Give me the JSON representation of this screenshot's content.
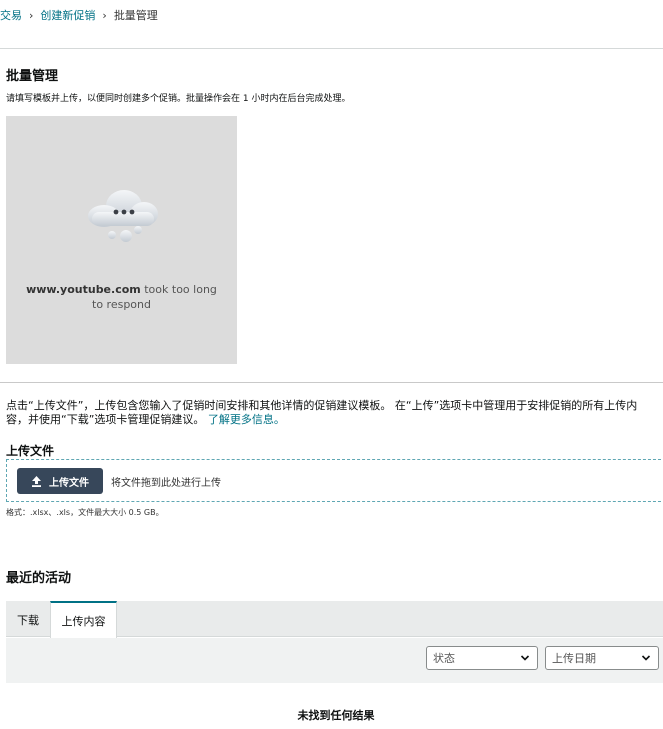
{
  "breadcrumb": {
    "items": [
      "交易",
      "创建新促销"
    ],
    "current": "批量管理",
    "separator": "›"
  },
  "page": {
    "title": "批量管理",
    "description": "请填写模板并上传，以便同时创建多个促销。批量操作会在 1 小时内在后台完成处理。"
  },
  "video": {
    "host": "www.youtube.com",
    "message": " took too long to respond"
  },
  "info": {
    "text": "点击“上传文件”，上传包含您输入了促销时间安排和其他详情的促销建议模板。 在“上传”选项卡中管理用于安排促销的所有上传内容，并使用“下载”选项卡管理促销建议。",
    "link": "了解更多信息。"
  },
  "upload": {
    "label": "上传文件",
    "button": "上传文件",
    "drop_hint": "将文件拖到此处进行上传",
    "format_note": "格式：.xlsx、.xls，文件最大大小 0.5 GB。"
  },
  "activity": {
    "title": "最近的活动",
    "tabs": [
      "下载",
      "上传内容"
    ],
    "active_tab": "上传内容",
    "filters": {
      "status": "状态",
      "upload_date": "上传日期"
    },
    "empty_message": "未找到任何结果"
  },
  "colors": {
    "link": "#007185",
    "button": "#37475a",
    "tab_accent": "#007185"
  }
}
